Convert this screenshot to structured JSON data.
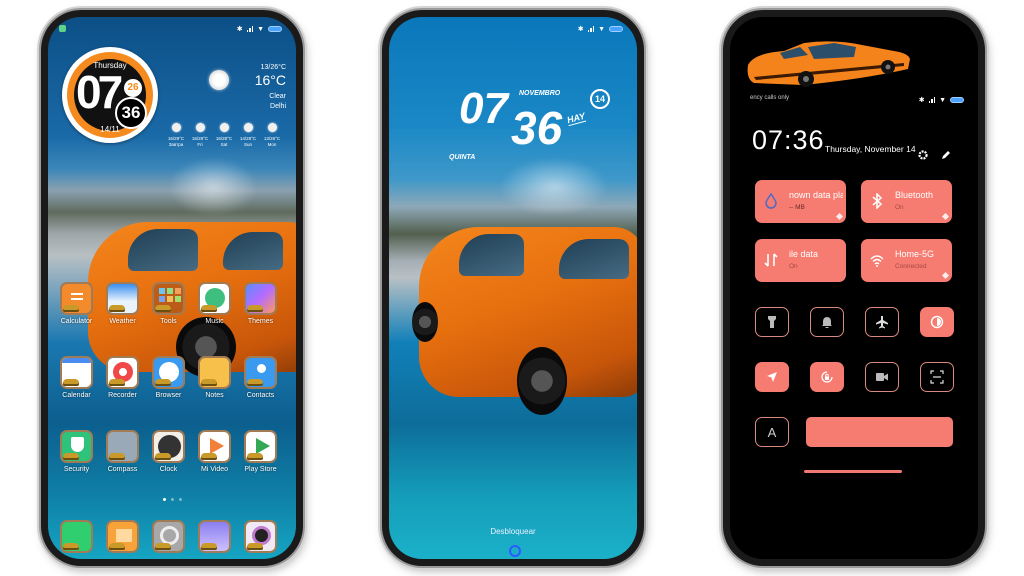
{
  "phone_home": {
    "status_bar": {
      "notification_icon": "app-notification-icon",
      "icons": [
        "bluetooth-icon",
        "signal-icon",
        "wifi-icon",
        "battery-icon"
      ]
    },
    "clock_widget": {
      "day": "Thursday",
      "hour": "07",
      "minute": "36",
      "seconds": "26",
      "date": "14/11"
    },
    "weather": {
      "range": "13/26°C",
      "temp": "16°C",
      "condition": "Clear",
      "city": "Delhi",
      "forecast": [
        {
          "temp": "16/29°C",
          "day": "Завтра"
        },
        {
          "temp": "16/28°C",
          "day": "Fri"
        },
        {
          "temp": "16/28°C",
          "day": "Sat"
        },
        {
          "temp": "14/28°C",
          "day": "Sun"
        },
        {
          "temp": "13/26°C",
          "day": "Mon"
        }
      ]
    },
    "apps": [
      {
        "label": "Calculator"
      },
      {
        "label": "Weather"
      },
      {
        "label": "Tools"
      },
      {
        "label": "Music"
      },
      {
        "label": "Themes"
      },
      {
        "label": "Calendar"
      },
      {
        "label": "Recorder"
      },
      {
        "label": "Browser"
      },
      {
        "label": "Notes"
      },
      {
        "label": "Contacts"
      },
      {
        "label": "Security"
      },
      {
        "label": "Compass"
      },
      {
        "label": "Clock"
      },
      {
        "label": "Mi Video"
      },
      {
        "label": "Play Store"
      }
    ],
    "dock": [
      {
        "name": "phone"
      },
      {
        "name": "messages"
      },
      {
        "name": "settings"
      },
      {
        "name": "gallery"
      },
      {
        "name": "camera"
      }
    ],
    "page_indicator": {
      "pages": 3,
      "current": 1
    }
  },
  "phone_lock": {
    "hour": "07",
    "minute": "36",
    "month": "NOVEMBRO",
    "weekday": "QUINTA",
    "suffix": "HAY",
    "day": "14",
    "unlock_label": "Desbloquear"
  },
  "phone_control": {
    "emergency": "ency calls only",
    "time": "07:36",
    "date": "Thursday, November 14",
    "tiles": [
      {
        "title": "nown data pla",
        "sub": "-- MB",
        "icon": "water-drop-icon"
      },
      {
        "title": "Bluetooth",
        "sub": "On",
        "icon": "bluetooth-icon"
      },
      {
        "title": "ile data",
        "sub": "On",
        "icon": "mobile-data-icon"
      },
      {
        "title": "Home-5G",
        "sub": "Connected",
        "icon": "wifi-icon"
      }
    ],
    "toggles": [
      {
        "name": "flashlight",
        "on": false
      },
      {
        "name": "mute",
        "on": false
      },
      {
        "name": "airplane-mode",
        "on": false
      },
      {
        "name": "dark-mode",
        "on": true
      },
      {
        "name": "location",
        "on": true
      },
      {
        "name": "auto-rotate-lock",
        "on": true
      },
      {
        "name": "screen-recorder",
        "on": false
      },
      {
        "name": "scanner",
        "on": false
      }
    ],
    "auto_brightness_label": "A",
    "accent_color": "#f67b71"
  }
}
